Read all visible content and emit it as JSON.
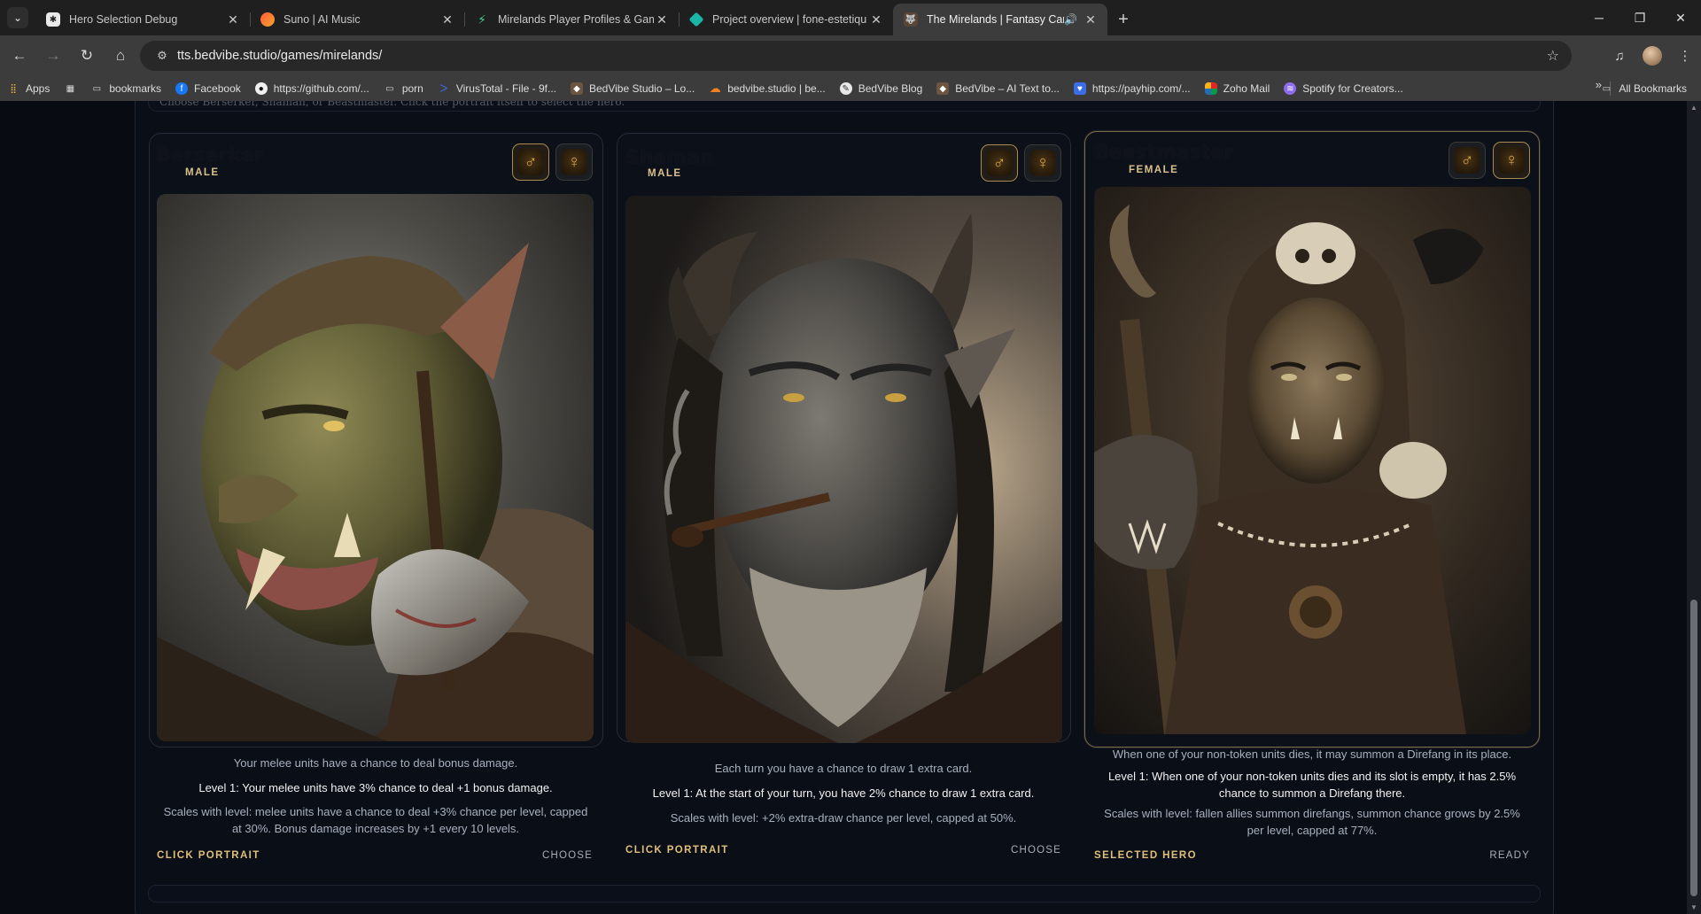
{
  "browser": {
    "tabs": [
      {
        "title": "Hero Selection Debug",
        "active": false
      },
      {
        "title": "Suno | AI Music",
        "active": false
      },
      {
        "title": "Mirelands Player Profiles & Gam",
        "active": false
      },
      {
        "title": "Project overview | fone-estetiqu",
        "active": false
      },
      {
        "title": "The Mirelands | Fantasy Car",
        "active": true
      }
    ],
    "url": "tts.bedvibe.studio/games/mirelands/",
    "bookmarks": [
      {
        "label": "Apps",
        "icon": "apps-grid-icon"
      },
      {
        "label": "",
        "icon": "tab-groups-icon"
      },
      {
        "label": "bookmarks",
        "icon": "folder-icon"
      },
      {
        "label": "Facebook",
        "icon": "facebook-icon"
      },
      {
        "label": "https://github.com/...",
        "icon": "github-icon"
      },
      {
        "label": "porn",
        "icon": "folder-icon"
      },
      {
        "label": "VirusTotal - File - 9f...",
        "icon": "virustotal-icon"
      },
      {
        "label": "BedVibe Studio – Lo...",
        "icon": "bedvibe-icon"
      },
      {
        "label": "bedvibe.studio | be...",
        "icon": "cloud-icon"
      },
      {
        "label": "BedVibe Blog",
        "icon": "blog-icon"
      },
      {
        "label": "BedVibe – AI Text to...",
        "icon": "bedvibe-icon"
      },
      {
        "label": "https://payhip.com/...",
        "icon": "payhip-icon"
      },
      {
        "label": "Zoho Mail",
        "icon": "zoho-icon"
      },
      {
        "label": "Spotify for Creators...",
        "icon": "spotify-icon"
      }
    ],
    "all_bookmarks": "All Bookmarks"
  },
  "page": {
    "intro": "Choose Berserker, Shaman, or Beastmaster. Click the portrait itself to select the hero.",
    "cards": [
      {
        "name": "Berserker",
        "gender": "MALE",
        "selected": false,
        "desc": "Your melee units have a chance to deal bonus damage.",
        "level": "Level 1: Your melee units have 3% chance to deal +1 bonus damage.",
        "scaling": "Scales with level: melee units have a chance to deal +3% chance per level, capped at 30%. Bonus damage increases by +1 every 10 levels.",
        "footer_left": "CLICK PORTRAIT",
        "footer_right": "CHOOSE"
      },
      {
        "name": "Shaman",
        "gender": "MALE",
        "selected": false,
        "desc": "Each turn you have a chance to draw 1 extra card.",
        "level": "Level 1: At the start of your turn, you have 2% chance to draw 1 extra card.",
        "scaling": "Scales with level: +2% extra-draw chance per level, capped at 50%.",
        "footer_left": "CLICK PORTRAIT",
        "footer_right": "CHOOSE"
      },
      {
        "name": "Beastmaster",
        "gender": "FEMALE",
        "selected": true,
        "desc": "When one of your non-token units dies, it may summon a Direfang in its place.",
        "level": "Level 1: When one of your non-token units dies and its slot is empty, it has 2.5% chance to summon a Direfang there.",
        "scaling": "Scales with level: fallen allies summon direfangs, summon chance grows by 2.5% per level, capped at 77%.",
        "footer_left": "SELECTED HERO",
        "footer_right": "READY"
      }
    ]
  }
}
